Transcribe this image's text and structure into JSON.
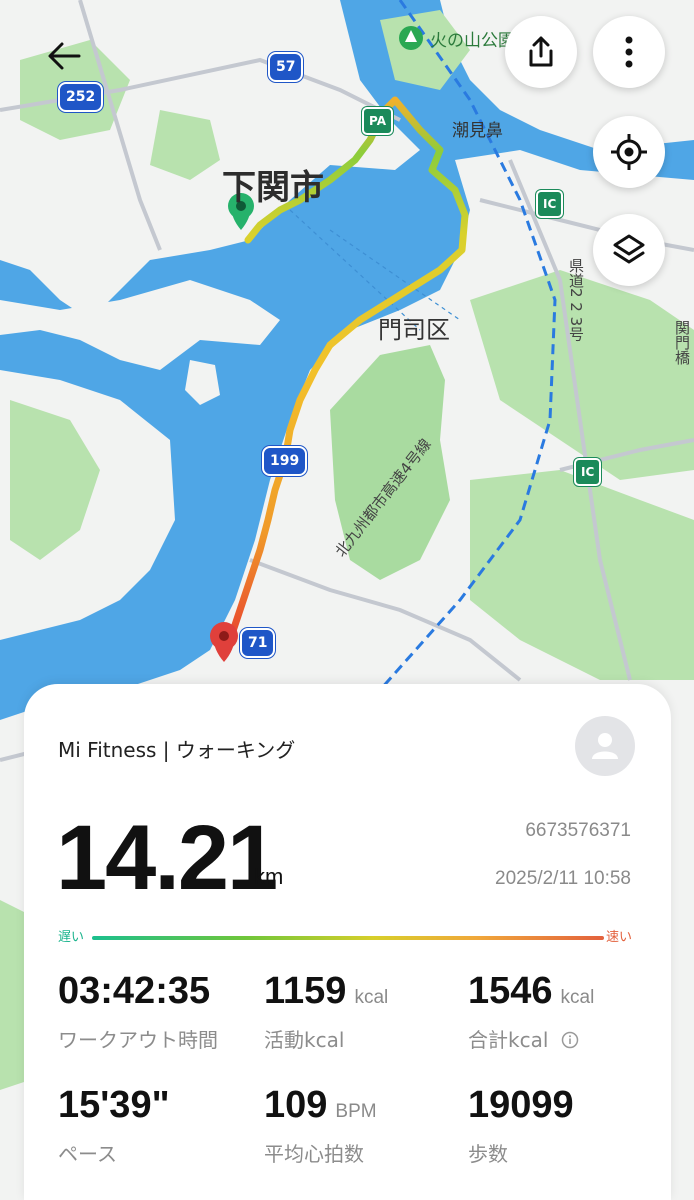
{
  "map": {
    "labels": {
      "city": "下関市",
      "district": "門司区",
      "cape": "潮見鼻",
      "park": "火の山公園",
      "road_kennado": "県道2 2 3号",
      "road_expressway": "北九州都市高速4号線",
      "road_bridge": "関門橋"
    },
    "shields": {
      "r252": "252",
      "r57": "57",
      "r199": "199",
      "r71": "71"
    },
    "badges": {
      "pa": "PA",
      "ic1": "IC",
      "ic2": "IC"
    },
    "colors": {
      "sea": "#4fa6e6",
      "land": "#f2f3f2",
      "green": "#a9dba0",
      "route_start": "#26b26b",
      "route_end": "#e0403b"
    }
  },
  "toolbar": {
    "back_icon": "arrow-left-icon",
    "share_icon": "share-icon",
    "more_icon": "more-vertical-icon",
    "locate_icon": "locate-icon",
    "layers_icon": "layers-icon"
  },
  "summary": {
    "app_title": "Mi Fitness | ウォーキング",
    "distance": "14.21",
    "distance_unit": "km",
    "id": "6673576371",
    "datetime": "2025/2/11 10:58",
    "speed_slow": "遅い",
    "speed_fast": "速い",
    "stats": [
      {
        "value": "03:42:35",
        "unit": "",
        "label": "ワークアウト時間"
      },
      {
        "value": "1159",
        "unit": "kcal",
        "label": "活動kcal"
      },
      {
        "value": "1546",
        "unit": "kcal",
        "label": "合計kcal"
      },
      {
        "value": "15'39\"",
        "unit": "",
        "label": "ペース"
      },
      {
        "value": "109",
        "unit": "BPM",
        "label": "平均心拍数"
      },
      {
        "value": "19099",
        "unit": "",
        "label": "歩数"
      }
    ]
  }
}
